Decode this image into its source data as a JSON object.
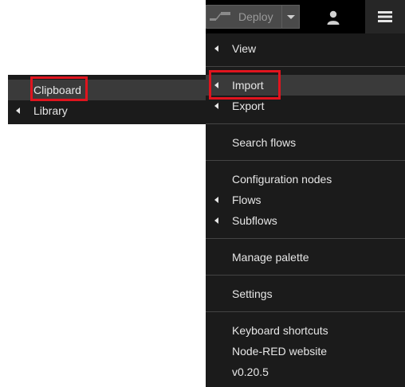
{
  "header": {
    "deploy_label": "Deploy",
    "deploy_icon": "deploy-flow-icon",
    "user_icon": "user-icon",
    "menu_icon": "hamburger-menu-icon"
  },
  "main_menu": {
    "items": [
      {
        "label": "View",
        "has_submenu": true
      },
      {
        "label": "Import",
        "has_submenu": true,
        "active": true
      },
      {
        "label": "Export",
        "has_submenu": true
      },
      {
        "label": "Search flows",
        "has_submenu": false
      },
      {
        "label": "Configuration nodes",
        "has_submenu": false
      },
      {
        "label": "Flows",
        "has_submenu": true
      },
      {
        "label": "Subflows",
        "has_submenu": true
      },
      {
        "label": "Manage palette",
        "has_submenu": false
      },
      {
        "label": "Settings",
        "has_submenu": false
      },
      {
        "label": "Keyboard shortcuts",
        "has_submenu": false
      },
      {
        "label": "Node-RED website",
        "has_submenu": false
      },
      {
        "label": "v0.20.5",
        "has_submenu": false
      }
    ]
  },
  "import_submenu": {
    "items": [
      {
        "label": "Clipboard",
        "has_submenu": false,
        "active": true
      },
      {
        "label": "Library",
        "has_submenu": true
      }
    ]
  },
  "colors": {
    "menu_bg": "#1b1b1b",
    "active_bg": "#3a3a3a",
    "highlight": "#e0141e"
  }
}
